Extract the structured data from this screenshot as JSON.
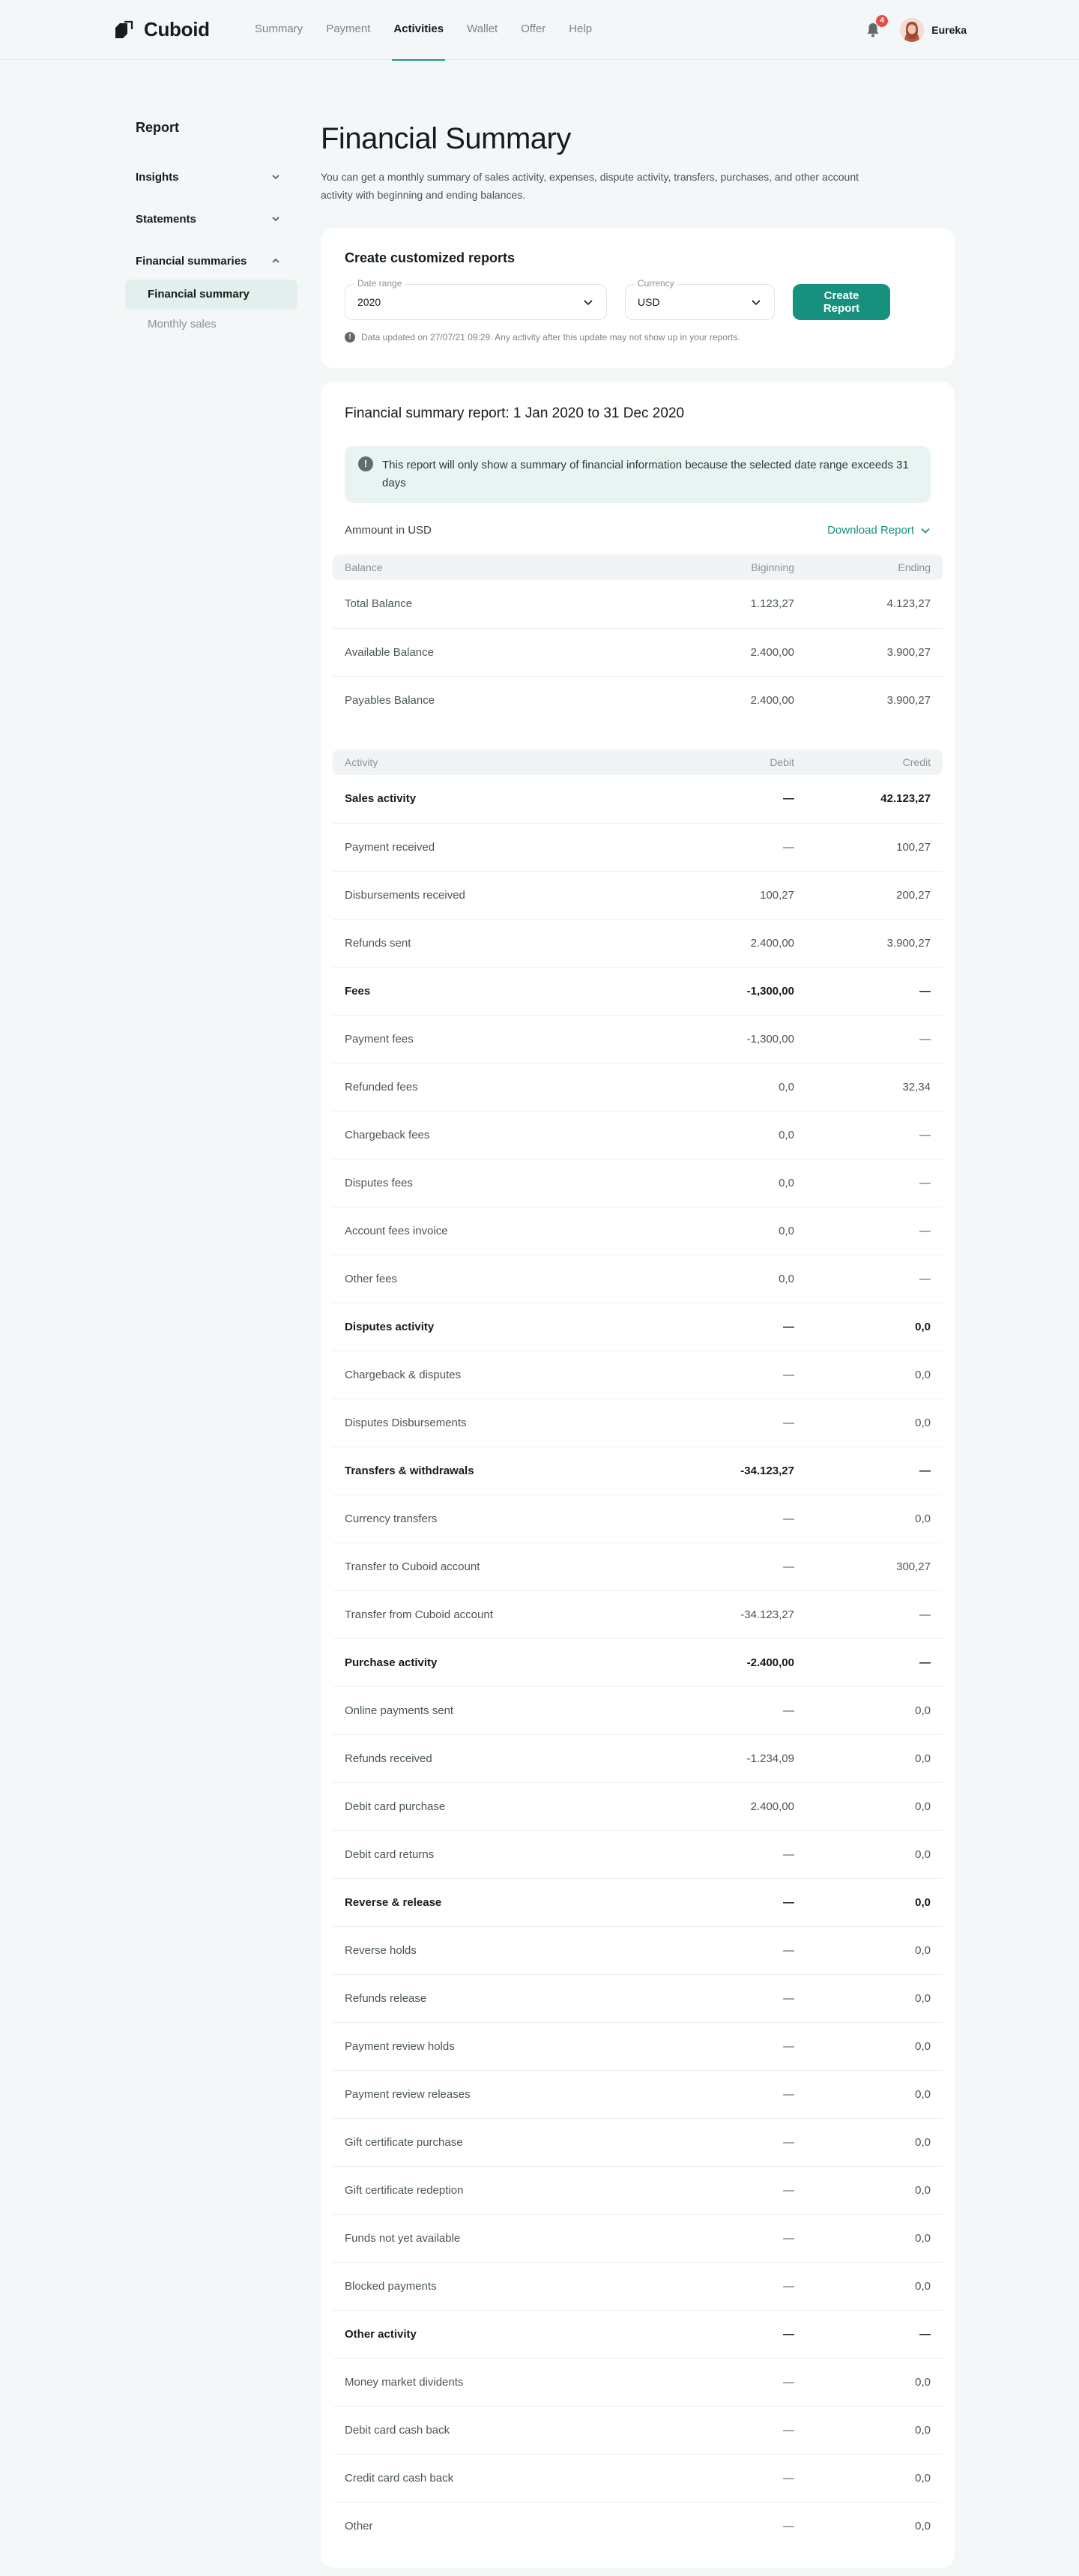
{
  "header": {
    "brand": "Cuboid",
    "nav": [
      "Summary",
      "Payment",
      "Activities",
      "Wallet",
      "Offer",
      "Help"
    ],
    "active_nav": "Activities",
    "notification_count": "4",
    "user_name": "Eureka"
  },
  "sidebar": {
    "title": "Report",
    "groups": [
      {
        "label": "Insights",
        "open": false
      },
      {
        "label": "Statements",
        "open": false
      },
      {
        "label": "Financial summaries",
        "open": true
      }
    ],
    "sub_items": [
      {
        "label": "Financial summary",
        "active": true
      },
      {
        "label": "Monthly sales",
        "active": false
      }
    ]
  },
  "page": {
    "title": "Financial Summary",
    "description": "You can get a monthly summary of sales activity, expenses, dispute activity, transfers, purchases, and other account activity with beginning and ending balances."
  },
  "create_card": {
    "title": "Create customized reports",
    "date_label": "Date range",
    "date_value": "2020",
    "currency_label": "Currency",
    "currency_value": "USD",
    "button": "Create Report",
    "info": "Data updated on 27/07/21 09:29. Any activity after this update may not show up in your reports."
  },
  "report": {
    "title": "Financial summary report: 1 Jan 2020 to 31 Dec 2020",
    "alert": "This report will only show a summary of financial information because the selected date range exceeds 31 days",
    "amount_label": "Ammount in USD",
    "download": "Download Report",
    "balance_headers": [
      "Balance",
      "Biginning",
      "Ending"
    ],
    "balance_rows": [
      {
        "label": "Total Balance",
        "a": "1.123,27",
        "b": "4.123,27",
        "bold": false
      },
      {
        "label": "Available Balance",
        "a": "2.400,00",
        "b": "3.900,27",
        "bold": false
      },
      {
        "label": "Payables Balance",
        "a": "2.400,00",
        "b": "3.900,27",
        "bold": false
      }
    ],
    "activity_headers": [
      "Activity",
      "Debit",
      "Credit"
    ],
    "activity_rows": [
      {
        "label": "Sales activity",
        "a": "—",
        "b": "42.123,27",
        "bold": true
      },
      {
        "label": "Payment received",
        "a": "—",
        "b": "100,27",
        "bold": false
      },
      {
        "label": "Disbursements received",
        "a": "100,27",
        "b": "200,27",
        "bold": false
      },
      {
        "label": "Refunds sent",
        "a": "2.400,00",
        "b": "3.900,27",
        "bold": false
      },
      {
        "label": "Fees",
        "a": "-1,300,00",
        "b": "—",
        "bold": true
      },
      {
        "label": "Payment fees",
        "a": "-1,300,00",
        "b": "—",
        "bold": false
      },
      {
        "label": "Refunded fees",
        "a": "0,0",
        "b": "32,34",
        "bold": false
      },
      {
        "label": "Chargeback fees",
        "a": "0,0",
        "b": "—",
        "bold": false
      },
      {
        "label": "Disputes fees",
        "a": "0,0",
        "b": "—",
        "bold": false
      },
      {
        "label": "Account fees invoice",
        "a": "0,0",
        "b": "—",
        "bold": false
      },
      {
        "label": "Other fees",
        "a": "0,0",
        "b": "—",
        "bold": false
      },
      {
        "label": "Disputes activity",
        "a": "—",
        "b": "0,0",
        "bold": true
      },
      {
        "label": "Chargeback & disputes",
        "a": "—",
        "b": "0,0",
        "bold": false
      },
      {
        "label": "Disputes Disbursements",
        "a": "—",
        "b": "0,0",
        "bold": false
      },
      {
        "label": "Transfers & withdrawals",
        "a": "-34.123,27",
        "b": "—",
        "bold": true
      },
      {
        "label": "Currency transfers",
        "a": "—",
        "b": "0,0",
        "bold": false
      },
      {
        "label": "Transfer to Cuboid account",
        "a": "—",
        "b": "300,27",
        "bold": false
      },
      {
        "label": "Transfer from Cuboid account",
        "a": "-34.123,27",
        "b": "—",
        "bold": false
      },
      {
        "label": "Purchase activity",
        "a": "-2.400,00",
        "b": "—",
        "bold": true
      },
      {
        "label": "Online payments sent",
        "a": "—",
        "b": "0,0",
        "bold": false
      },
      {
        "label": "Refunds received",
        "a": "-1.234,09",
        "b": "0,0",
        "bold": false
      },
      {
        "label": "Debit card purchase",
        "a": "2.400,00",
        "b": "0,0",
        "bold": false
      },
      {
        "label": "Debit card returns",
        "a": "—",
        "b": "0,0",
        "bold": false
      },
      {
        "label": "Reverse & release",
        "a": "—",
        "b": "0,0",
        "bold": true
      },
      {
        "label": "Reverse holds",
        "a": "—",
        "b": "0,0",
        "bold": false
      },
      {
        "label": "Refunds release",
        "a": "—",
        "b": "0,0",
        "bold": false
      },
      {
        "label": "Payment review holds",
        "a": "—",
        "b": "0,0",
        "bold": false
      },
      {
        "label": "Payment review releases",
        "a": "—",
        "b": "0,0",
        "bold": false
      },
      {
        "label": "Gift certificate purchase",
        "a": "—",
        "b": "0,0",
        "bold": false
      },
      {
        "label": "Gift certificate redeption",
        "a": "—",
        "b": "0,0",
        "bold": false
      },
      {
        "label": "Funds not yet available",
        "a": "—",
        "b": "0,0",
        "bold": false
      },
      {
        "label": "Blocked payments",
        "a": "—",
        "b": "0,0",
        "bold": false
      },
      {
        "label": "Other activity",
        "a": "—",
        "b": "—",
        "bold": true
      },
      {
        "label": "Money market dividents",
        "a": "—",
        "b": "0,0",
        "bold": false
      },
      {
        "label": "Debit card cash back",
        "a": "—",
        "b": "0,0",
        "bold": false
      },
      {
        "label": "Credit card cash back",
        "a": "—",
        "b": "0,0",
        "bold": false
      },
      {
        "label": "Other",
        "a": "—",
        "b": "0,0",
        "bold": false
      }
    ]
  },
  "colors": {
    "accent": "#17917d",
    "background": "#f3f7f7",
    "badge": "#e2504c"
  },
  "icons": [
    "cuboid-logo-icon",
    "bell-icon",
    "chevron-down-icon",
    "chevron-up-icon",
    "info-icon"
  ]
}
